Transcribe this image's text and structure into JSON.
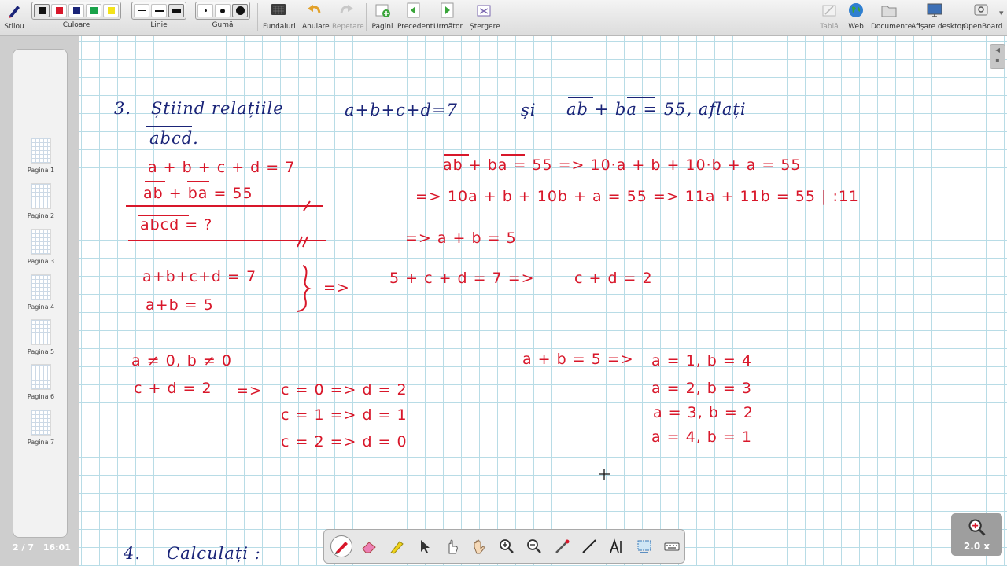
{
  "toolbar": {
    "pen": "Stilou",
    "color": "Culoare",
    "line": "Linie",
    "eraser": "Gumă",
    "backgrounds": "Fundaluri",
    "undo": "Anulare",
    "redo": "Repetare",
    "pages": "Pagini",
    "previous": "Precedent",
    "next": "Următor",
    "erase": "Ștergere",
    "board": "Tablă",
    "web": "Web",
    "documents": "Documente",
    "desktop": "Afișare desktop",
    "openboard": "OpenBoard",
    "colors": [
      "#111111",
      "#d8172a",
      "#1a2478",
      "#1aa34a",
      "#f3e21a"
    ]
  },
  "pages": [
    "Pagina 1",
    "Pagina 2",
    "Pagina 3",
    "Pagina 4",
    "Pagina 5",
    "Pagina 6",
    "Pagina 7"
  ],
  "status": {
    "page_counter": "2 / 7",
    "time": "16:01"
  },
  "zoom": {
    "value": "2.0 x"
  },
  "board": {
    "problem_number": "3.",
    "statement_a": "Știind relațiile",
    "statement_b": "a+b+c+d=7",
    "statement_c": "și",
    "statement_d": "ab + ba = 55, aflați",
    "statement_e": "abcd.",
    "given_1": "a + b + c + d = 7",
    "given_2": "ab + ba = 55",
    "given_3": "abcd = ?",
    "rhs_1": "ab + ba = 55 => 10·a + b + 10·b + a = 55",
    "rhs_2": "=> 10a + b + 10b + a = 55 => 11a + 11b = 55 | :11",
    "rhs_3": "=> a + b = 5",
    "sys_1": "a+b+c+d = 7",
    "sys_2": "a+b = 5",
    "sys_arrow": "=>",
    "sys_result": "5 + c + d = 7 =>",
    "sys_cd": "c + d = 2",
    "cond": "a ≠ 0, b ≠ 0",
    "cd_line": "c + d = 2",
    "cd_arrow": "=>",
    "case_1": "c = 0 => d = 2",
    "case_2": "c = 1 => d = 1",
    "case_3": "c = 2 => d = 0",
    "ab_line": "a + b = 5 =>",
    "ab_1": "a = 1, b = 4",
    "ab_2": "a = 2, b = 3",
    "ab_3": "a = 3, b = 2",
    "ab_4": "a = 4, b = 1",
    "next_number": "4.",
    "next_title": "Calculați :"
  }
}
